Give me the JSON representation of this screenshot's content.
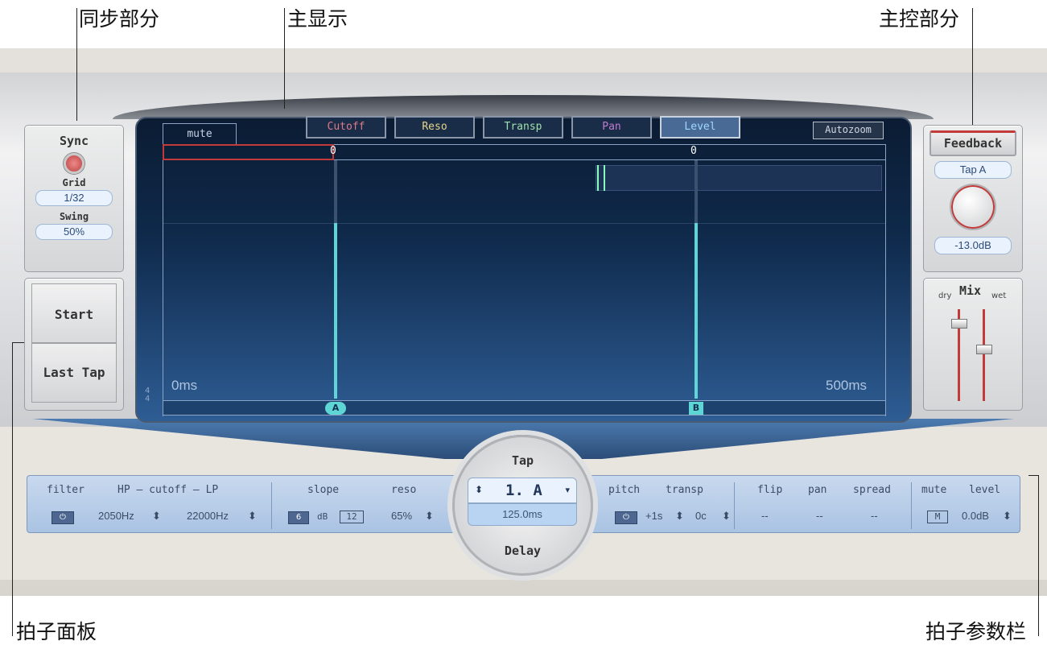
{
  "annotations": {
    "sync_section": "同步部分",
    "main_display": "主显示",
    "master_section": "主控部分",
    "tap_pads": "拍子面板",
    "tap_parameter_bar": "拍子参数栏"
  },
  "sync": {
    "title": "Sync",
    "grid_label": "Grid",
    "grid_value": "1/32",
    "swing_label": "Swing",
    "swing_value": "50%"
  },
  "tap_pads": {
    "start": "Start",
    "last_tap": "Last Tap"
  },
  "display": {
    "mute_tab": "mute",
    "buttons": [
      "Cutoff",
      "Reso",
      "Transp",
      "Pan",
      "Level"
    ],
    "autozoom": "Autozoom",
    "time_start": "0ms",
    "time_end": "500ms",
    "time_signature": "4\n4",
    "tap_a": "A",
    "tap_b": "B",
    "marker_a": "0",
    "marker_b": "0"
  },
  "master": {
    "feedback": "Feedback",
    "tap_select": "Tap A",
    "value": "-13.0dB",
    "mix": "Mix",
    "dry": "dry",
    "wet": "wet"
  },
  "tap_delay": {
    "tap": "Tap",
    "current_tap": "1. A",
    "delay_time": "125.0ms",
    "delay": "Delay"
  },
  "param_bar": {
    "filter": "filter",
    "filter_cutoff": "HP – cutoff – LP",
    "hp_value": "2050Hz",
    "lp_value": "22000Hz",
    "slope": "slope",
    "slope_6": "6",
    "slope_db": "dB",
    "slope_12": "12",
    "reso": "reso",
    "reso_value": "65%",
    "pitch": "pitch",
    "transp": "transp",
    "pitch_value": "+1s",
    "transp_value": "0c",
    "flip": "flip",
    "pan": "pan",
    "spread": "spread",
    "flip_value": "--",
    "pan_value": "--",
    "spread_value": "--",
    "mute": "mute",
    "level": "level",
    "mute_value": "M",
    "level_value": "0.0dB"
  },
  "colors": {
    "accent_cyan": "#5fd6d6",
    "accent_red": "#c23a3a",
    "display_bg": "#0f2a4c"
  }
}
